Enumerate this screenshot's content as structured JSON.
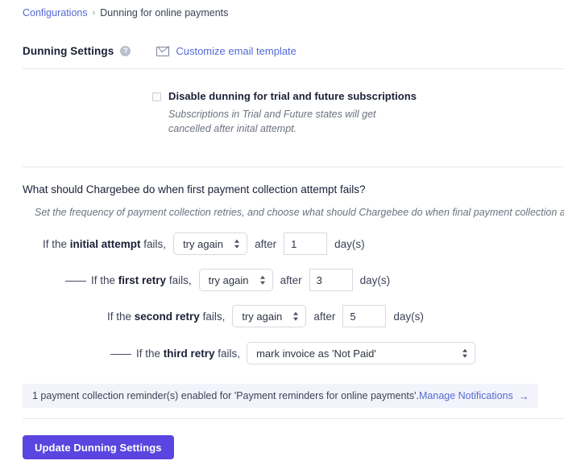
{
  "breadcrumb": {
    "root": "Configurations",
    "separator": "›",
    "current": "Dunning for online payments"
  },
  "section": {
    "title": "Dunning Settings",
    "help_icon": "question-mark-icon",
    "help_glyph": "?",
    "email_template_link": "Customize email template",
    "email_icon": "envelope-icon"
  },
  "disable_dunning": {
    "checked": false,
    "label": "Disable dunning for trial and future subscriptions",
    "description": "Subscriptions in Trial and Future states will get cancelled after inital attempt."
  },
  "retry_config": {
    "question": "What should Chargebee do when first payment collection attempt fails?",
    "description": "Set the frequency of payment collection retries, and choose what should Chargebee do when final payment collection attempt fa",
    "days_label": "day(s)",
    "after_label": "after",
    "dash": "——",
    "rows": [
      {
        "dash": "",
        "prefix": "If the ",
        "emphasis": "initial attempt",
        "suffix": " fails,",
        "action": "try again",
        "delay": "1",
        "has_delay": true
      },
      {
        "dash": "——",
        "prefix": "If the ",
        "emphasis": "first retry",
        "suffix": " fails,",
        "action": "try again",
        "delay": "3",
        "has_delay": true
      },
      {
        "dash": "",
        "prefix": "If the ",
        "emphasis": "second retry",
        "suffix": " fails,",
        "action": "try again",
        "delay": "5",
        "has_delay": true
      },
      {
        "dash": "——",
        "prefix": "If the ",
        "emphasis": "third retry",
        "suffix": " fails,",
        "action": "mark invoice as 'Not Paid'",
        "delay": "",
        "has_delay": false
      }
    ]
  },
  "notification_banner": {
    "text": "1 payment collection reminder(s) enabled for 'Payment reminders for online payments'.",
    "link_label": "Manage Notifications",
    "arrow_glyph": "→"
  },
  "footer": {
    "submit_label": "Update Dunning Settings"
  },
  "colors": {
    "accent": "#5469d4",
    "button": "#5b45e0",
    "banner_bg": "#f3f4fb",
    "divider": "#e6e8ec",
    "text_dark": "#1a1f36",
    "text_muted": "#6b7280"
  }
}
